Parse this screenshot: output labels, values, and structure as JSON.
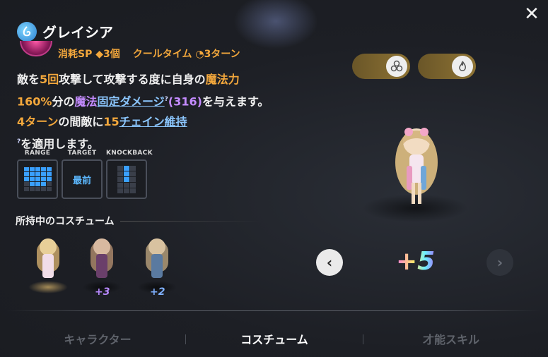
{
  "header": {
    "character_name": "グレイシア",
    "element_icon": "water-element-icon",
    "close_icon": "close-icon"
  },
  "skill": {
    "cost_label": "消耗SP",
    "cost_value": "◆3個",
    "cooldown_label": "クールタイム",
    "cooldown_value": "3ターン",
    "description_parts": {
      "p1": "敵を",
      "n1": "5回",
      "p2": "攻撃して攻撃する度に自身の",
      "k1": "魔法力",
      "n2": "160%",
      "p3": "分の",
      "k2": "魔法",
      "link1": "固定ダメージ",
      "val1": "(316)",
      "p4": "を与えます。 ",
      "n3": "4ターン",
      "p5": "の間敵に",
      "n4": "15",
      "link2": "チェイン維持",
      "p6": "を適用します。",
      "qmark": "?"
    }
  },
  "stats": {
    "range_label": "RANGE",
    "target_label": "TARGET",
    "target_value": "最前",
    "knockback_label": "KNOCKBACK"
  },
  "costumes": {
    "section_title": "所持中のコスチューム",
    "items": [
      {
        "plus": ""
      },
      {
        "plus": "+3"
      },
      {
        "plus": "+2"
      }
    ]
  },
  "viewer": {
    "toggle1_icon": "triple-circle-icon",
    "toggle2_icon": "flame-icon",
    "plus_level": "+5",
    "prev_icon": "chevron-left-icon",
    "next_icon": "chevron-right-icon"
  },
  "tabs": [
    {
      "label": "キャラクター"
    },
    {
      "label": "コスチューム"
    },
    {
      "label": "才能スキル"
    }
  ],
  "colors": {
    "accent_orange": "#f4a83c",
    "accent_purple": "#c48bff",
    "link_blue": "#8cc7ff",
    "range_blue": "#3aa0ff"
  }
}
